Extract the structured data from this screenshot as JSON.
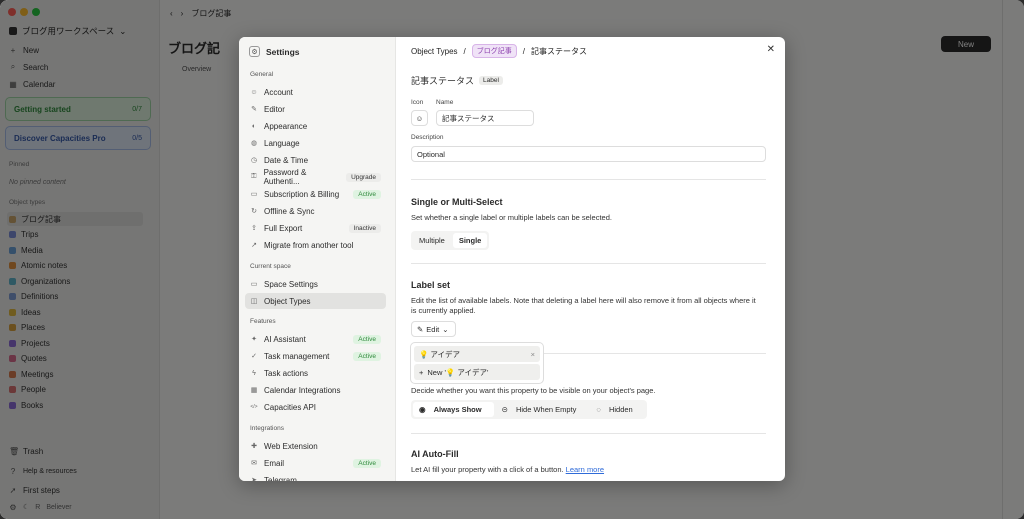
{
  "sidebar": {
    "workspace": "ブログ用ワークスペース",
    "new": "New",
    "search": "Search",
    "calendar": "Calendar",
    "card1": {
      "label": "Getting started",
      "count": "0/7"
    },
    "card2": {
      "label": "Discover Capacities Pro",
      "count": "0/5"
    },
    "pinned": "Pinned",
    "no_pinned": "No pinned content",
    "object_types": "Object types",
    "types": [
      {
        "label": "ブログ記事",
        "color": "#c8a56a"
      },
      {
        "label": "Trips",
        "color": "#7b8cd6"
      },
      {
        "label": "Media",
        "color": "#6aa0d6"
      },
      {
        "label": "Atomic notes",
        "color": "#e0903f"
      },
      {
        "label": "Organizations",
        "color": "#5fb3c9"
      },
      {
        "label": "Definitions",
        "color": "#7f9cd4"
      },
      {
        "label": "Ideas",
        "color": "#e0b83f"
      },
      {
        "label": "Places",
        "color": "#d6a03f"
      },
      {
        "label": "Projects",
        "color": "#8c6ad6"
      },
      {
        "label": "Quotes",
        "color": "#d66a8c"
      },
      {
        "label": "Meetings",
        "color": "#d67a4f"
      },
      {
        "label": "People",
        "color": "#d67070"
      },
      {
        "label": "Books",
        "color": "#8a6ad6"
      }
    ],
    "trash": "Trash",
    "help": "Help & resources",
    "first_steps": "First steps",
    "user": "Believer"
  },
  "topbar": {
    "breadcrumb": "ブログ記事",
    "title": "ブログ記",
    "new_button": "New",
    "tab": "Overview"
  },
  "modal": {
    "title": "Settings",
    "sections": {
      "general": "General",
      "current": "Current space",
      "features": "Features",
      "integrations": "Integrations"
    },
    "general_items": [
      {
        "label": "Account",
        "icon": "user-icon",
        "badge": ""
      },
      {
        "label": "Editor",
        "icon": "edit-icon",
        "badge": ""
      },
      {
        "label": "Appearance",
        "icon": "palette-icon",
        "badge": ""
      },
      {
        "label": "Language",
        "icon": "globe-icon",
        "badge": ""
      },
      {
        "label": "Date & Time",
        "icon": "clock-icon",
        "badge": ""
      },
      {
        "label": "Password & Authenti...",
        "icon": "key-icon",
        "badge": "Upgrade"
      },
      {
        "label": "Subscription & Billing",
        "icon": "card-icon",
        "badge": "Active"
      },
      {
        "label": "Offline & Sync",
        "icon": "sync-icon",
        "badge": ""
      },
      {
        "label": "Full Export",
        "icon": "export-icon",
        "badge": "Inactive"
      },
      {
        "label": "Migrate from another tool",
        "icon": "migrate-icon",
        "badge": ""
      }
    ],
    "current_items": [
      {
        "label": "Space Settings",
        "icon": "monitor-icon",
        "badge": ""
      },
      {
        "label": "Object Types",
        "icon": "box-icon",
        "badge": ""
      }
    ],
    "feature_items": [
      {
        "label": "AI Assistant",
        "icon": "sparkle-icon",
        "badge": "Active"
      },
      {
        "label": "Task management",
        "icon": "check-icon",
        "badge": "Active"
      },
      {
        "label": "Task actions",
        "icon": "bolt-icon",
        "badge": ""
      },
      {
        "label": "Calendar Integrations",
        "icon": "calendar-icon",
        "badge": ""
      },
      {
        "label": "Capacities API",
        "icon": "code-icon",
        "badge": ""
      }
    ],
    "integration_items": [
      {
        "label": "Web Extension",
        "icon": "puzzle-icon",
        "badge": ""
      },
      {
        "label": "Email",
        "icon": "mail-icon",
        "badge": "Active"
      },
      {
        "label": "Telegram",
        "icon": "send-icon",
        "badge": ""
      }
    ],
    "content": {
      "crumb_root": "Object Types",
      "crumb_type": "ブログ記事",
      "crumb_prop": "記事ステータス",
      "heading": "記事ステータス",
      "heading_tag": "Label",
      "icon_label": "Icon",
      "name_label": "Name",
      "name_value": "記事ステータス",
      "desc_label": "Description",
      "desc_placeholder": "Optional",
      "select_title": "Single or Multi-Select",
      "select_desc": "Set whether a single label or multiple labels can be selected.",
      "opt_multiple": "Multiple",
      "opt_single": "Single",
      "labelset_title": "Label set",
      "labelset_desc": "Edit the list of available labels. Note that deleting a label here will also remove it from all objects where it is currently applied.",
      "edit": "Edit",
      "dropdown_item": "💡 アイデア",
      "dropdown_new": "New '💡 アイデア'",
      "visibility_desc": "Decide whether you want this property to be visible on your object's page.",
      "vis_always": "Always Show",
      "vis_empty": "Hide When Empty",
      "vis_hidden": "Hidden",
      "ai_title": "AI Auto-Fill",
      "ai_desc": "Let AI fill your property with a click of a button.",
      "ai_link": "Learn more"
    }
  }
}
